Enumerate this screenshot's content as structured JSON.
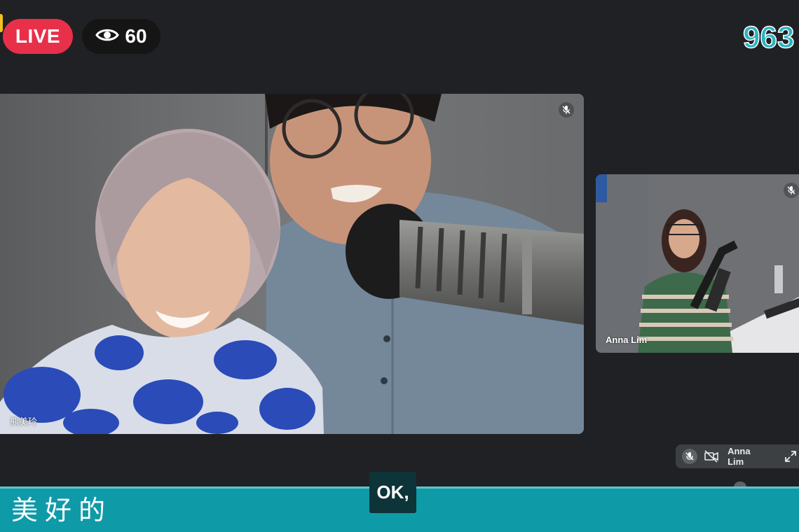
{
  "overlay": {
    "live_label": "LIVE",
    "viewer_count": "60",
    "eye_icon": "eye-icon",
    "station_logo_text": "963"
  },
  "tiles": [
    {
      "name": "熊美玲",
      "muted": true
    },
    {
      "name": "Anna Lim",
      "muted": true
    }
  ],
  "self_view": {
    "name": "Anna Lim",
    "icons": [
      "mic-off-icon",
      "camera-off-icon",
      "expand-icon"
    ]
  },
  "caption": {
    "ticker_text": "美好的",
    "subtitle": "OK,"
  },
  "colors": {
    "live_red": "#e8304a",
    "caption_teal": "#0f9aa8",
    "background": "#202124"
  }
}
